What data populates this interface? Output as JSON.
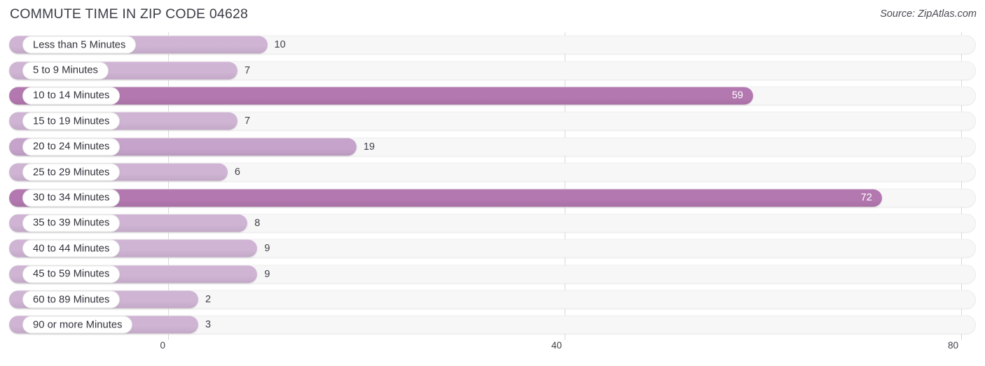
{
  "header": {
    "title": "COMMUTE TIME IN ZIP CODE 04628",
    "source": "Source: ZipAtlas.com"
  },
  "colors": {
    "bar_light": "#cfb4d4",
    "bar_mid": "#c6a3cb",
    "bar_dark": "#b378b0",
    "track": "#f7f7f7",
    "gridline": "#d8d8d8",
    "value_text": "#40404a",
    "value_text_inside": "#ffffff"
  },
  "axis": {
    "ticks": [
      "0",
      "40",
      "80"
    ],
    "min": 0,
    "max": 80
  },
  "chart_data": {
    "type": "bar",
    "orientation": "horizontal",
    "title": "COMMUTE TIME IN ZIP CODE 04628",
    "xlabel": "",
    "ylabel": "",
    "xlim": [
      0,
      80
    ],
    "grid": true,
    "legend": "none",
    "categories": [
      "Less than 5 Minutes",
      "5 to 9 Minutes",
      "10 to 14 Minutes",
      "15 to 19 Minutes",
      "20 to 24 Minutes",
      "25 to 29 Minutes",
      "30 to 34 Minutes",
      "35 to 39 Minutes",
      "40 to 44 Minutes",
      "45 to 59 Minutes",
      "60 to 89 Minutes",
      "90 or more Minutes"
    ],
    "values": [
      10,
      7,
      59,
      7,
      19,
      6,
      72,
      8,
      9,
      9,
      2,
      3
    ]
  }
}
